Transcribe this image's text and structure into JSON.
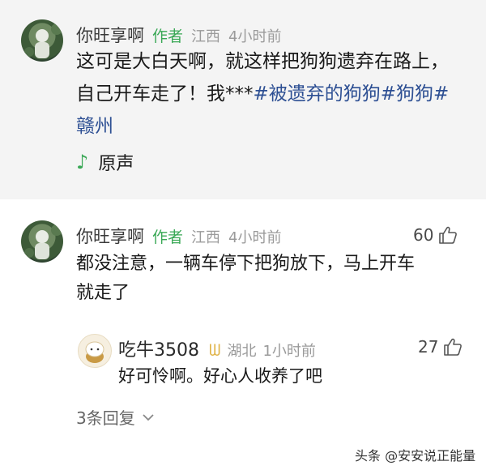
{
  "post": {
    "author_name": "你旺享啊",
    "author_tag": "作者",
    "location": "江西",
    "time": "4小时前",
    "text_line1": "这可是大白天啊，就这样把狗狗遗弃在路上，",
    "text_line2_plain": "自己开车走了！我***",
    "hashtags_inline": "#被遗弃的狗狗#狗狗#",
    "hashtag_line3": "赣州",
    "audio_label": "原声"
  },
  "comment": {
    "author_name": "你旺享啊",
    "author_tag": "作者",
    "location": "江西",
    "time": "4小时前",
    "like_count": "60",
    "text_line1": "都没注意，一辆车停下把狗放下，马上开车",
    "text_line2": "就走了"
  },
  "reply": {
    "author_name": "吃牛3508",
    "location": "湖北",
    "time": "1小时前",
    "like_count": "27",
    "text": "好可怜啊。好心人收养了吧"
  },
  "more_replies_label": "3条回复",
  "watermark": "头条 @安安说正能量",
  "colors": {
    "author_tag": "#3aa856",
    "hashtag": "#2d4f93",
    "post_bg": "#f4f4f4"
  },
  "icons": [
    "music-note-icon",
    "thumbs-up-icon",
    "chevron-down-icon",
    "badge-icon"
  ]
}
